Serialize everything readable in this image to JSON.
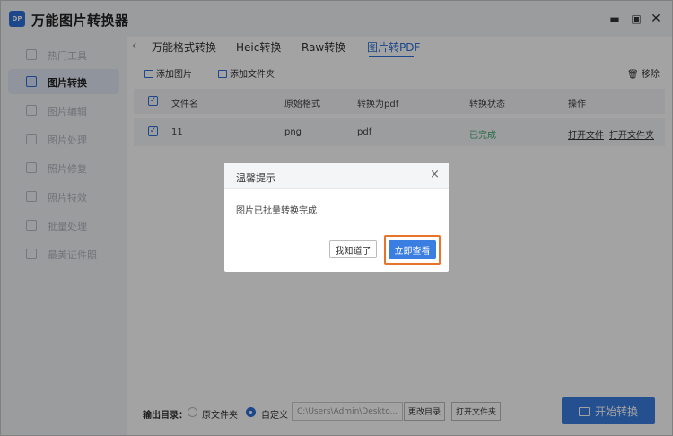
{
  "app": {
    "logo_text": "DP",
    "title": "万能图片转换器",
    "window_buttons": [
      "minimize-icon",
      "maximize-icon",
      "close-icon"
    ]
  },
  "sidebar": {
    "items": [
      {
        "label": "热门工具",
        "active": false
      },
      {
        "label": "图片转换",
        "active": true
      },
      {
        "label": "图片编辑",
        "active": false
      },
      {
        "label": "图片处理",
        "active": false
      },
      {
        "label": "照片修复",
        "active": false
      },
      {
        "label": "照片特效",
        "active": false
      },
      {
        "label": "批量处理",
        "active": false
      },
      {
        "label": "最美证件照",
        "active": false
      }
    ]
  },
  "tabs": {
    "items": [
      {
        "label": "万能格式转换"
      },
      {
        "label": "Heic转换"
      },
      {
        "label": "Raw转换"
      },
      {
        "label": "图片转PDF",
        "active": true
      }
    ]
  },
  "toolbar": {
    "add_image": "添加图片",
    "add_folder": "添加文件夹",
    "remove": "移除"
  },
  "table": {
    "headers": [
      "文件名",
      "原始格式",
      "转换为pdf",
      "转换状态",
      "操作"
    ],
    "rows": [
      {
        "name": "11",
        "source_format": "png",
        "target_format": "pdf",
        "status": "已完成",
        "action_open_file": "打开文件",
        "action_open_folder": "打开文件夹"
      }
    ]
  },
  "bottom": {
    "output_label": "输出目录：",
    "option_original": "原文件夹",
    "option_custom": "自定义",
    "path_value": "C:\\Users\\Admin\\Deskto...",
    "change_dir": "更改目录",
    "open_folder": "打开文件夹",
    "start": "开始转换"
  },
  "dialog": {
    "title": "温馨提示",
    "message": "图片已批量转换完成",
    "close_symbol": "×",
    "btn_know": "我知道了",
    "btn_view": "立即查看"
  },
  "colors": {
    "accent": "#3b7ee2",
    "success": "#3ca86b",
    "highlight": "#e8732b"
  }
}
